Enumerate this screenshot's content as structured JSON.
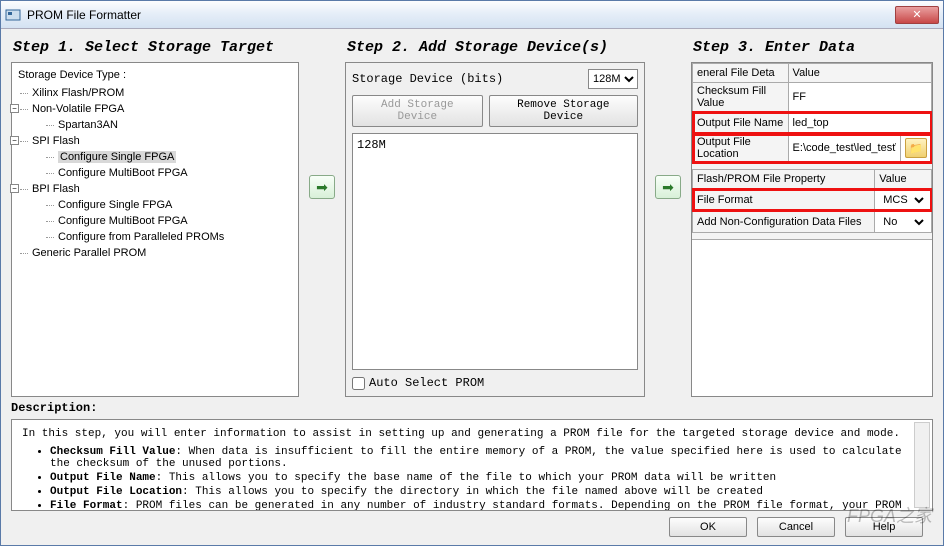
{
  "title": "PROM File Formatter",
  "steps": {
    "s1": {
      "header": "Step 1.   Select Storage Target"
    },
    "s2": {
      "header": "Step 2.   Add Storage Device(s)"
    },
    "s3": {
      "header": "Step 3.              Enter Data"
    }
  },
  "tree": {
    "label": "Storage Device Type :",
    "xilinx": "Xilinx Flash/PROM",
    "nonvol": "Non-Volatile FPGA",
    "spartan": "Spartan3AN",
    "spi": "SPI Flash",
    "spi_single": "Configure Single FPGA",
    "spi_multi": "Configure MultiBoot FPGA",
    "bpi": "BPI Flash",
    "bpi_single": "Configure Single FPGA",
    "bpi_multi": "Configure MultiBoot FPGA",
    "bpi_par": "Configure from Paralleled PROMs",
    "generic": "Generic Parallel PROM"
  },
  "s2": {
    "bits_label": "Storage Device (bits)",
    "bits_val": "128M",
    "add_btn": "Add Storage Device",
    "remove_btn": "Remove Storage Device",
    "list_item": "128M",
    "auto": "Auto Select PROM"
  },
  "s3": {
    "h1a": "eneral File Deta",
    "h1b": "Value",
    "r1a": "Checksum Fill Value",
    "r1b": "FF",
    "r2a": "Output File Name",
    "r2b": "led_top",
    "r3a": "Output File Location",
    "r3b": "E:\\code_test\\led_test\\",
    "h2a": "Flash/PROM File Property",
    "h2b": "Value",
    "r4a": "File Format",
    "r4b": "MCS",
    "r5a": "Add Non-Configuration Data Files",
    "r5b": "No"
  },
  "desc": {
    "label": "Description:",
    "intro": "In this step, you will enter information to assist in setting up and generating a PROM file for the targeted storage device and mode.",
    "b1t": "Checksum Fill Value",
    "b1": ": When data is insufficient to fill the entire memory of a PROM, the value specified here is used to calculate the checksum of the unused portions.",
    "b2t": "Output File Name",
    "b2": ": This allows you to specify the base name of the file to which your PROM data will be written",
    "b3t": "Output File Location",
    "b3": ": This allows you to specify the directory in which the file named above will be created",
    "b4t": "File Format",
    "b4": ": PROM files can be generated in any number of industry standard formats. Depending on the PROM file format, your PROM programmer"
  },
  "footer": {
    "ok": "OK",
    "cancel": "Cancel",
    "help": "Help"
  },
  "watermark": "FPGA之家"
}
